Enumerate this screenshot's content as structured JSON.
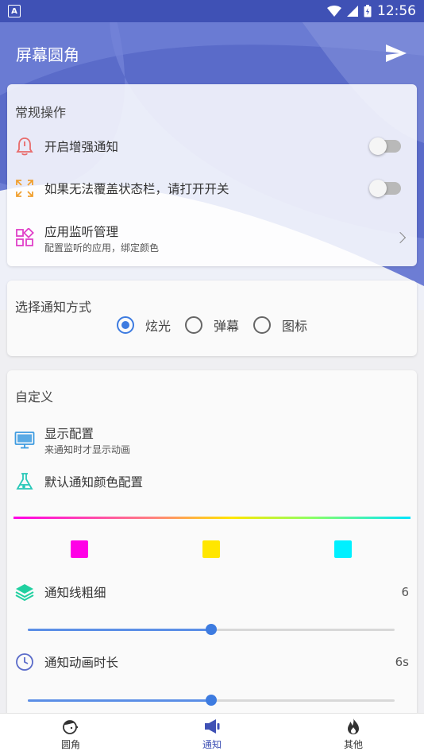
{
  "status_bar": {
    "app_glyph": "A",
    "time": "12:56"
  },
  "app_bar": {
    "title": "屏幕圆角"
  },
  "general_card": {
    "title": "常规操作",
    "items": [
      {
        "label": "开启增强通知",
        "icon": "bell-icon",
        "icon_color": "#e86b6b"
      },
      {
        "label": "如果无法覆盖状态栏，请打开开关",
        "icon": "expand-icon",
        "icon_color": "#f0a030"
      },
      {
        "label": "应用监听管理",
        "sub": "配置监听的应用，绑定颜色",
        "icon": "apps-icon",
        "icon_color": "#e040c8"
      }
    ]
  },
  "notify_mode_card": {
    "title": "选择通知方式",
    "options": [
      {
        "label": "炫光",
        "selected": true
      },
      {
        "label": "弹幕",
        "selected": false
      },
      {
        "label": "图标",
        "selected": false
      }
    ]
  },
  "custom_card": {
    "title": "自定义",
    "display_config": {
      "label": "显示配置",
      "sub": "来通知时才显示动画",
      "icon_color": "#3d9be0"
    },
    "default_color": {
      "label": "默认通知颜色配置",
      "icon_color": "#28c8b8"
    },
    "swatches": [
      "#ff00e6",
      "#ffe600",
      "#00f0ff"
    ],
    "line_width": {
      "label": "通知线粗细",
      "value": "6",
      "fraction": 0.5,
      "icon_color": "#20d0a0"
    },
    "duration": {
      "label": "通知动画时长",
      "value": "6s",
      "fraction": 0.5,
      "icon_color": "#5a6bc9"
    }
  },
  "bottom_nav": [
    {
      "label": "圆角",
      "active": false
    },
    {
      "label": "通知",
      "active": true
    },
    {
      "label": "其他",
      "active": false
    }
  ],
  "colors": {
    "primary": "#3f51b5",
    "accent": "#3d7be0"
  }
}
